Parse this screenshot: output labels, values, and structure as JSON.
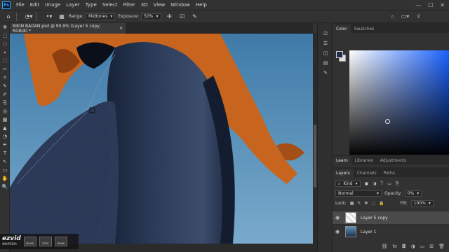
{
  "menubar": {
    "logo": "Ps",
    "items": [
      "File",
      "Edit",
      "Image",
      "Layer",
      "Type",
      "Select",
      "Filter",
      "3D",
      "View",
      "Window",
      "Help"
    ],
    "controls": [
      "—",
      "☐",
      "✕"
    ]
  },
  "options": {
    "range_label": "Range:",
    "range_value": "Midtones",
    "exposure_label": "Exposure:",
    "exposure_value": "50%"
  },
  "document": {
    "tab_title": "BIKIN BADAN.psd @ 90,9% (Layer 5 copy, RGB/8) *",
    "close": "×"
  },
  "tools": [
    "✥",
    "⬚",
    "◌",
    "⌖",
    "⛶",
    "✂",
    "⌾",
    "✎",
    "✐",
    "⎘",
    "◎",
    "▦",
    "▲",
    "◔",
    "✒",
    "T",
    "↖",
    "▭",
    "✋",
    "🔍"
  ],
  "watermark": {
    "logo": "ezvid",
    "sub": "WIKIPEDIA",
    "buttons": [
      "PAUSE",
      "STOP",
      "DRAW"
    ]
  },
  "color_panel": {
    "tabs": [
      "Color",
      "Swatches"
    ],
    "active_tab": "Color",
    "foreground": "#1f2d4d",
    "background": "#e0e0e0"
  },
  "learn_tabs": [
    "Learn",
    "Libraries",
    "Adjustments"
  ],
  "layers_panel": {
    "tabs": [
      "Layers",
      "Channels",
      "Paths"
    ],
    "filter_value": "Kind",
    "blend_mode": "Normal",
    "opacity_label": "Opacity:",
    "opacity_value": "0%",
    "lock_label": "Lock:",
    "fill_label": "Fill:",
    "fill_value": "100%",
    "layers": [
      {
        "name": "Layer 5 copy",
        "selected": true
      },
      {
        "name": "Layer 1",
        "selected": false
      }
    ]
  }
}
